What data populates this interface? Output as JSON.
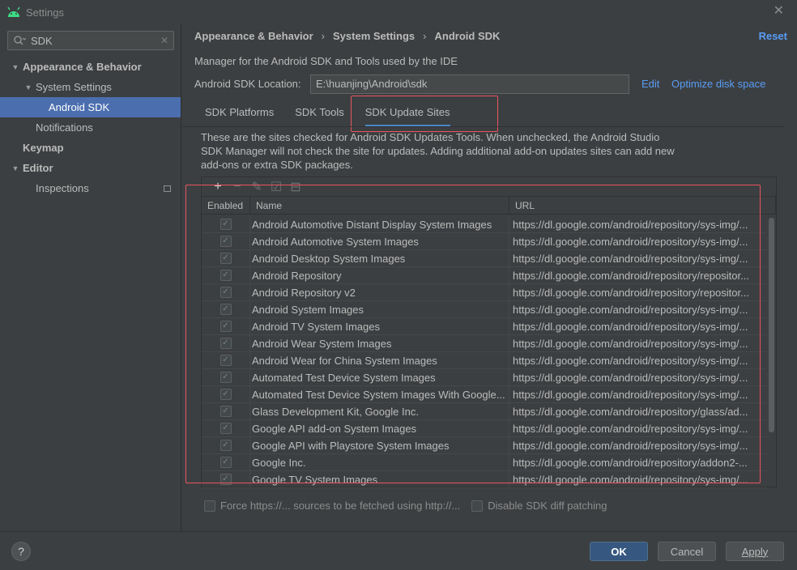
{
  "window": {
    "title": "Settings"
  },
  "search": {
    "value": "SDK"
  },
  "sidebar": {
    "items": [
      {
        "label": "Appearance & Behavior",
        "arrow": "▼",
        "indent": 0,
        "bold": true,
        "selected": false
      },
      {
        "label": "System Settings",
        "arrow": "▼",
        "indent": 1,
        "bold": false,
        "selected": false
      },
      {
        "label": "Android SDK",
        "arrow": "",
        "indent": 2,
        "bold": false,
        "selected": true
      },
      {
        "label": "Notifications",
        "arrow": "",
        "indent": 1,
        "bold": false,
        "selected": false
      },
      {
        "label": "Keymap",
        "arrow": "",
        "indent": 0,
        "bold": true,
        "selected": false
      },
      {
        "label": "Editor",
        "arrow": "▼",
        "indent": 0,
        "bold": true,
        "selected": false
      },
      {
        "label": "Inspections",
        "arrow": "",
        "indent": 1,
        "bold": false,
        "selected": false
      }
    ]
  },
  "breadcrumb": {
    "part1": "Appearance & Behavior",
    "part2": "System Settings",
    "part3": "Android SDK",
    "sep": "›"
  },
  "reset_label": "Reset",
  "description": "Manager for the Android SDK and Tools used by the IDE",
  "location": {
    "label": "Android SDK Location:",
    "value": "E:\\huanjing\\Android\\sdk",
    "edit": "Edit",
    "optimize": "Optimize disk space"
  },
  "tabs": [
    {
      "label": "SDK Platforms",
      "active": false
    },
    {
      "label": "SDK Tools",
      "active": false
    },
    {
      "label": "SDK Update Sites",
      "active": true
    }
  ],
  "info_text": "These are the sites checked for Android SDK Updates Tools. When unchecked, the Android Studio SDK Manager will not check the site for updates. Adding additional add-on updates sites can add new add-ons or extra SDK packages.",
  "table": {
    "headers": {
      "enabled": "Enabled",
      "name": "Name",
      "url": "URL"
    },
    "rows": [
      {
        "name": "Android Automotive Distant Display System Images",
        "url": "https://dl.google.com/android/repository/sys-img/..."
      },
      {
        "name": "Android Automotive System Images",
        "url": "https://dl.google.com/android/repository/sys-img/..."
      },
      {
        "name": "Android Desktop System Images",
        "url": "https://dl.google.com/android/repository/sys-img/..."
      },
      {
        "name": "Android Repository",
        "url": "https://dl.google.com/android/repository/repositor..."
      },
      {
        "name": "Android Repository v2",
        "url": "https://dl.google.com/android/repository/repositor..."
      },
      {
        "name": "Android System Images",
        "url": "https://dl.google.com/android/repository/sys-img/..."
      },
      {
        "name": "Android TV System Images",
        "url": "https://dl.google.com/android/repository/sys-img/..."
      },
      {
        "name": "Android Wear System Images",
        "url": "https://dl.google.com/android/repository/sys-img/..."
      },
      {
        "name": "Android Wear for China System Images",
        "url": "https://dl.google.com/android/repository/sys-img/..."
      },
      {
        "name": "Automated Test Device System Images",
        "url": "https://dl.google.com/android/repository/sys-img/..."
      },
      {
        "name": "Automated Test Device System Images With Google...",
        "url": "https://dl.google.com/android/repository/sys-img/..."
      },
      {
        "name": "Glass Development Kit, Google Inc.",
        "url": "https://dl.google.com/android/repository/glass/ad..."
      },
      {
        "name": "Google API add-on System Images",
        "url": "https://dl.google.com/android/repository/sys-img/..."
      },
      {
        "name": "Google API with Playstore System Images",
        "url": "https://dl.google.com/android/repository/sys-img/..."
      },
      {
        "name": "Google Inc.",
        "url": "https://dl.google.com/android/repository/addon2-..."
      },
      {
        "name": "Google TV System Images",
        "url": "https://dl.google.com/android/repository/sys-img/..."
      }
    ]
  },
  "options": {
    "force_https": "Force https://... sources to be fetched using http://...",
    "disable_diff": "Disable SDK diff patching"
  },
  "buttons": {
    "help": "?",
    "ok": "OK",
    "cancel": "Cancel",
    "apply": "Apply"
  },
  "colors": {
    "accent": "#4b6eaf",
    "link": "#589df6",
    "highlight": "#e8555f",
    "background": "#3c3f41"
  }
}
